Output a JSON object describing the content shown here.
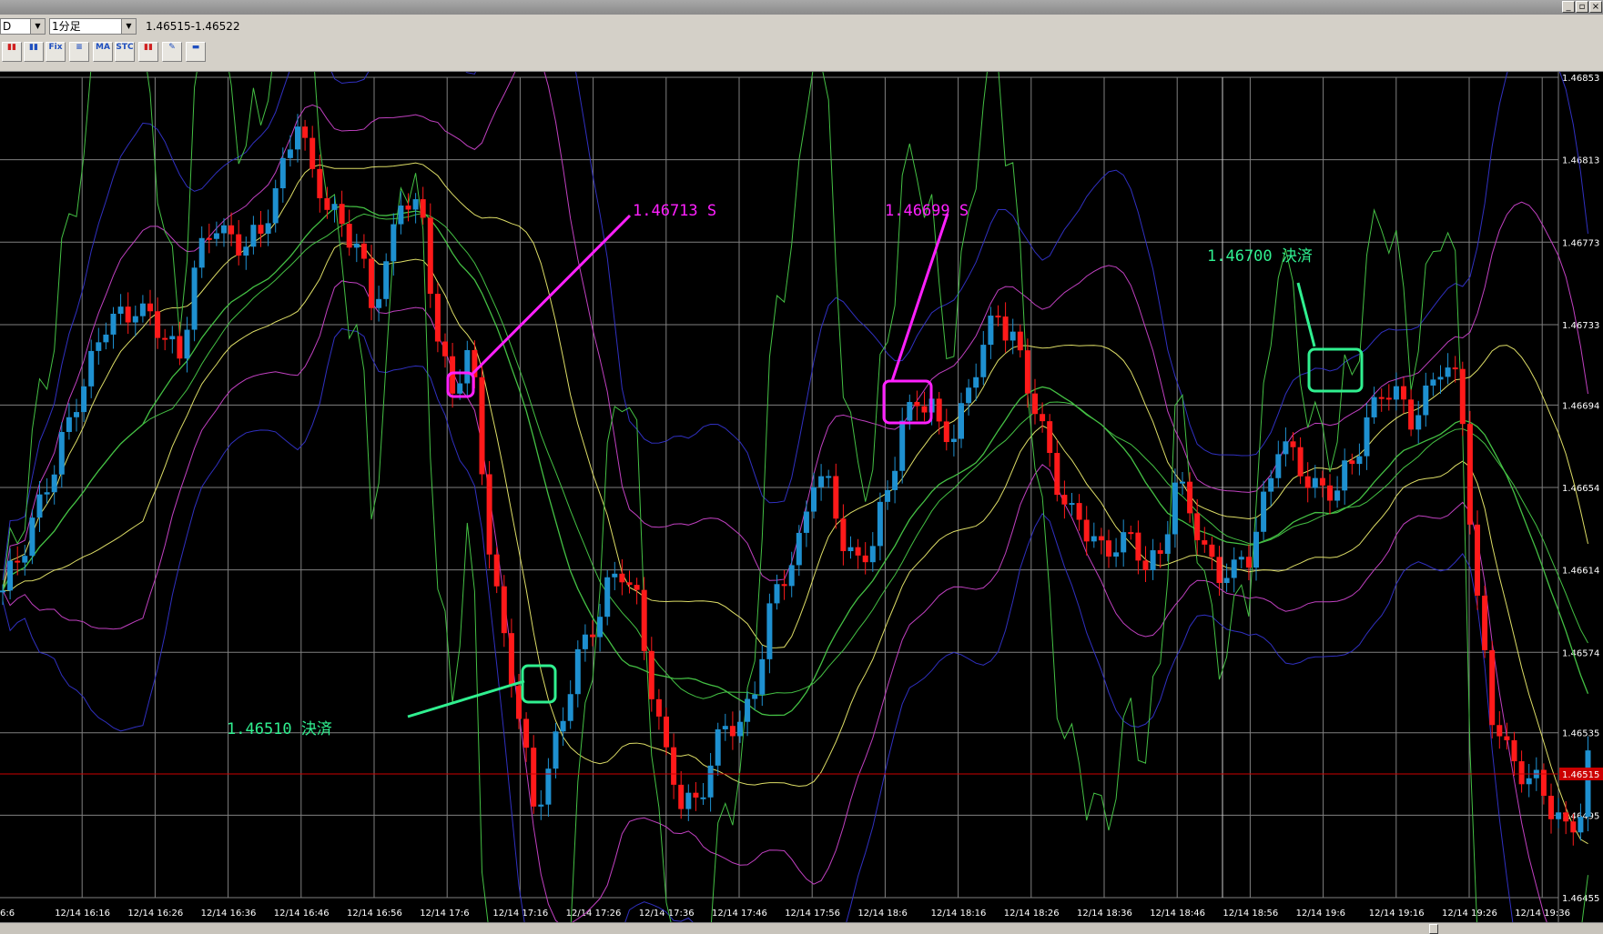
{
  "toolbar": {
    "symbol": "D",
    "timeframe": "1分足",
    "price_range": "1.46515-1.46522",
    "icons": [
      {
        "name": "candlestick-icon",
        "glyph": "▮▮"
      },
      {
        "name": "bar-chart-icon",
        "glyph": "▮▮"
      },
      {
        "name": "fix-icon",
        "glyph": "Fix"
      },
      {
        "name": "line-chart-icon",
        "glyph": "≡"
      },
      {
        "name": "ma-fix-icon",
        "glyph": "MA"
      },
      {
        "name": "stc-fix-icon",
        "glyph": "STC"
      },
      {
        "name": "indicator-icon",
        "glyph": "▮▮"
      },
      {
        "name": "pen-icon",
        "glyph": "✎"
      },
      {
        "name": "print-icon",
        "glyph": "▬"
      }
    ]
  },
  "colors": {
    "background": "#000000",
    "grid": "#808080",
    "axis_text": "#ffffff",
    "up": "#1e90d0",
    "down": "#ff1a1a",
    "magenta": "#ff20ff",
    "green": "#30f090",
    "yellow_line": "#dddd66",
    "green_line": "#44c044",
    "purple_line": "#c040c0",
    "blue_line": "#3030c0",
    "current_price": "#cc0000"
  },
  "chart_data": {
    "type": "candlestick",
    "y_ticks": [
      "1.46853",
      "1.46813",
      "1.46773",
      "1.46733",
      "1.46694",
      "1.46654",
      "1.46614",
      "1.46574",
      "1.46535",
      "1.46495",
      "1.46455"
    ],
    "x_ticks": [
      "6:6",
      "12/14 16:16",
      "12/14 16:26",
      "12/14 16:36",
      "12/14 16:46",
      "12/14 16:56",
      "12/14 17:6",
      "12/14 17:16",
      "12/14 17:26",
      "12/14 17:36",
      "12/14 17:46",
      "12/14 17:56",
      "12/14 18:6",
      "12/14 18:16",
      "12/14 18:26",
      "12/14 18:36",
      "12/14 18:46",
      "12/14 18:56",
      "12/14 19:6",
      "12/14 19:16",
      "12/14 19:26",
      "12/14 19:36"
    ],
    "current_price": "1.46515",
    "ylim": [
      1.46455,
      1.46853
    ],
    "close_path": [
      [
        0,
        1.466
      ],
      [
        4,
        1.4664
      ],
      [
        7,
        1.4666
      ],
      [
        10,
        1.467
      ],
      [
        14,
        1.4673
      ],
      [
        18,
        1.46745
      ],
      [
        21,
        1.46728
      ],
      [
        24,
        1.4672
      ],
      [
        26,
        1.4676
      ],
      [
        29,
        1.4678
      ],
      [
        32,
        1.46775
      ],
      [
        35,
        1.46772
      ],
      [
        37,
        1.468
      ],
      [
        40,
        1.46835
      ],
      [
        42,
        1.468
      ],
      [
        45,
        1.4679
      ],
      [
        48,
        1.4677
      ],
      [
        50,
        1.4674
      ],
      [
        52,
        1.46765
      ],
      [
        54,
        1.46795
      ],
      [
        57,
        1.4678
      ],
      [
        59,
        1.4673
      ],
      [
        61,
        1.467
      ],
      [
        63,
        1.46715
      ],
      [
        64,
        1.467
      ],
      [
        66,
        1.4663
      ],
      [
        68,
        1.4658
      ],
      [
        70,
        1.4654
      ],
      [
        72,
        1.465
      ],
      [
        74,
        1.4652
      ],
      [
        76,
        1.4654
      ],
      [
        78,
        1.4657
      ],
      [
        80,
        1.4659
      ],
      [
        82,
        1.46605
      ],
      [
        84,
        1.4661
      ],
      [
        86,
        1.466
      ],
      [
        88,
        1.4656
      ],
      [
        90,
        1.4652
      ],
      [
        92,
        1.465
      ],
      [
        94,
        1.46505
      ],
      [
        96,
        1.4652
      ],
      [
        98,
        1.46535
      ],
      [
        100,
        1.4654
      ],
      [
        102,
        1.4656
      ],
      [
        104,
        1.4659
      ],
      [
        106,
        1.4661
      ],
      [
        108,
        1.4663
      ],
      [
        110,
        1.4666
      ],
      [
        112,
        1.4665
      ],
      [
        114,
        1.4663
      ],
      [
        116,
        1.4662
      ],
      [
        118,
        1.46625
      ],
      [
        120,
        1.4665
      ],
      [
        122,
        1.4669
      ],
      [
        124,
        1.46695
      ],
      [
        126,
        1.4669
      ],
      [
        127,
        1.4668
      ],
      [
        129,
        1.46685
      ],
      [
        131,
        1.467
      ],
      [
        133,
        1.4672
      ],
      [
        135,
        1.4674
      ],
      [
        137,
        1.4673
      ],
      [
        139,
        1.467
      ],
      [
        141,
        1.4668
      ],
      [
        143,
        1.4666
      ],
      [
        145,
        1.4664
      ],
      [
        147,
        1.4663
      ],
      [
        149,
        1.46625
      ],
      [
        151,
        1.4663
      ],
      [
        153,
        1.46625
      ],
      [
        155,
        1.46615
      ],
      [
        157,
        1.46625
      ],
      [
        159,
        1.46655
      ],
      [
        161,
        1.4664
      ],
      [
        163,
        1.46625
      ],
      [
        165,
        1.46615
      ],
      [
        167,
        1.4661
      ],
      [
        169,
        1.4662
      ],
      [
        171,
        1.4665
      ],
      [
        173,
        1.46675
      ],
      [
        175,
        1.46665
      ],
      [
        177,
        1.4666
      ],
      [
        179,
        1.46655
      ],
      [
        181,
        1.4665
      ],
      [
        183,
        1.46665
      ],
      [
        185,
        1.4669
      ],
      [
        187,
        1.467
      ],
      [
        189,
        1.46695
      ],
      [
        191,
        1.4669
      ],
      [
        193,
        1.467
      ],
      [
        195,
        1.4671
      ],
      [
        197,
        1.46705
      ],
      [
        198,
        1.4669
      ],
      [
        200,
        1.466
      ],
      [
        202,
        1.4654
      ],
      [
        204,
        1.46525
      ],
      [
        206,
        1.4652
      ],
      [
        208,
        1.4651
      ],
      [
        210,
        1.46495
      ],
      [
        212,
        1.4649
      ],
      [
        214,
        1.465
      ],
      [
        215,
        1.4652
      ]
    ]
  },
  "annotations": {
    "entry1": "1.46713 S",
    "entry2": "1.46699 S",
    "exit1": "1.46510 決済",
    "exit2": "1.46700 決済"
  }
}
